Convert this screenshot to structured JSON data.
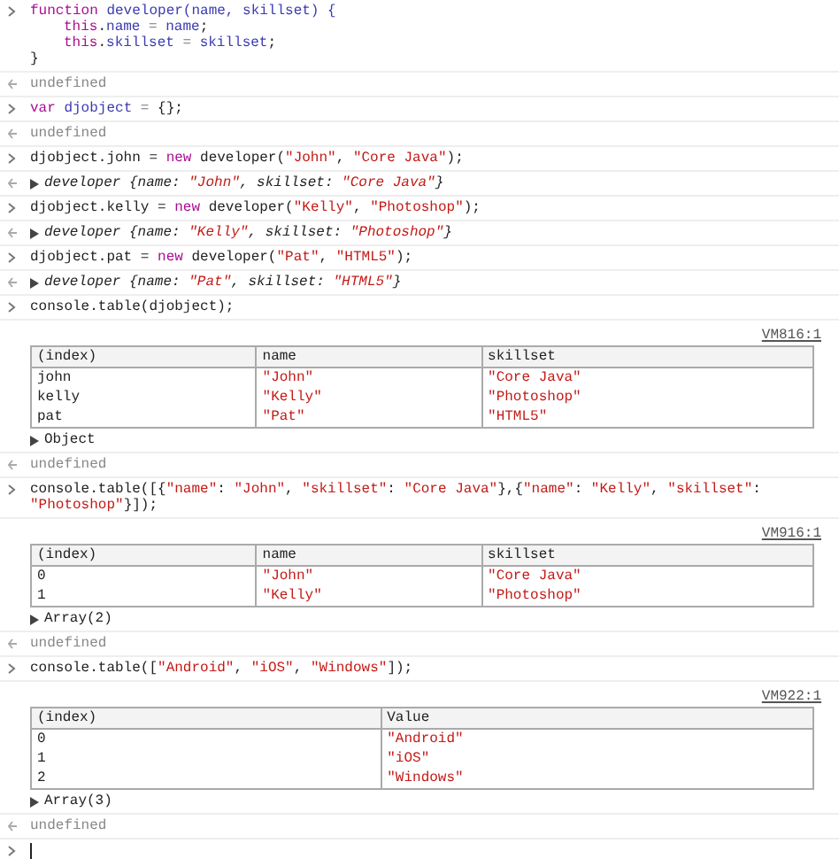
{
  "entries": [
    {
      "kind": "input",
      "lines": [
        {
          "segments": [
            {
              "kind": "kw",
              "text": "function"
            },
            {
              "kind": "def",
              "text": " developer(name, skillset) {"
            }
          ],
          "children": [
            {
              "segments": [
                {
                  "kind": "kw",
                  "text": "this"
                },
                {
                  "kind": "plain",
                  "text": "."
                },
                {
                  "kind": "def",
                  "text": "name"
                },
                {
                  "kind": "op",
                  "text": " = "
                },
                {
                  "kind": "def",
                  "text": "name"
                },
                {
                  "kind": "plain",
                  "text": ";"
                }
              ]
            },
            {
              "segments": [
                {
                  "kind": "kw",
                  "text": "this"
                },
                {
                  "kind": "plain",
                  "text": "."
                },
                {
                  "kind": "def",
                  "text": "skillset"
                },
                {
                  "kind": "op",
                  "text": " = "
                },
                {
                  "kind": "def",
                  "text": "skillset"
                },
                {
                  "kind": "plain",
                  "text": ";"
                }
              ]
            }
          ]
        },
        {
          "segments": [
            {
              "kind": "plain",
              "text": "}"
            }
          ]
        }
      ]
    },
    {
      "kind": "result",
      "text": "undefined"
    },
    {
      "kind": "input",
      "lines": [
        {
          "segments": [
            {
              "kind": "kw",
              "text": "var"
            },
            {
              "kind": "def",
              "text": " djobject"
            },
            {
              "kind": "op",
              "text": " = "
            },
            {
              "kind": "plain",
              "text": "{};"
            }
          ]
        }
      ]
    },
    {
      "kind": "result",
      "text": "undefined"
    },
    {
      "kind": "input",
      "lines": [
        {
          "segments": [
            {
              "kind": "plain",
              "text": "djobject.john = "
            },
            {
              "kind": "kw",
              "text": "new"
            },
            {
              "kind": "plain",
              "text": " developer("
            },
            {
              "kind": "str",
              "text": "\"John\""
            },
            {
              "kind": "plain",
              "text": ", "
            },
            {
              "kind": "str",
              "text": "\"Core Java\""
            },
            {
              "kind": "plain",
              "text": ");"
            }
          ]
        }
      ]
    },
    {
      "kind": "object",
      "segments": [
        {
          "kind": "plain",
          "text": "developer {name: "
        },
        {
          "kind": "str",
          "text": "\"John\""
        },
        {
          "kind": "plain",
          "text": ", skillset: "
        },
        {
          "kind": "str",
          "text": "\"Core Java\""
        },
        {
          "kind": "plain",
          "text": "}"
        }
      ]
    },
    {
      "kind": "input",
      "lines": [
        {
          "segments": [
            {
              "kind": "plain",
              "text": "djobject.kelly = "
            },
            {
              "kind": "kw",
              "text": "new"
            },
            {
              "kind": "plain",
              "text": " developer("
            },
            {
              "kind": "str",
              "text": "\"Kelly\""
            },
            {
              "kind": "plain",
              "text": ", "
            },
            {
              "kind": "str",
              "text": "\"Photoshop\""
            },
            {
              "kind": "plain",
              "text": ");"
            }
          ]
        }
      ]
    },
    {
      "kind": "object",
      "segments": [
        {
          "kind": "plain",
          "text": "developer {name: "
        },
        {
          "kind": "str",
          "text": "\"Kelly\""
        },
        {
          "kind": "plain",
          "text": ", skillset: "
        },
        {
          "kind": "str",
          "text": "\"Photoshop\""
        },
        {
          "kind": "plain",
          "text": "}"
        }
      ]
    },
    {
      "kind": "input",
      "lines": [
        {
          "segments": [
            {
              "kind": "plain",
              "text": "djobject.pat = "
            },
            {
              "kind": "kw",
              "text": "new"
            },
            {
              "kind": "plain",
              "text": " developer("
            },
            {
              "kind": "str",
              "text": "\"Pat\""
            },
            {
              "kind": "plain",
              "text": ", "
            },
            {
              "kind": "str",
              "text": "\"HTML5\""
            },
            {
              "kind": "plain",
              "text": ");"
            }
          ]
        }
      ]
    },
    {
      "kind": "object",
      "segments": [
        {
          "kind": "plain",
          "text": "developer {name: "
        },
        {
          "kind": "str",
          "text": "\"Pat\""
        },
        {
          "kind": "plain",
          "text": ", skillset: "
        },
        {
          "kind": "str",
          "text": "\"HTML5\""
        },
        {
          "kind": "plain",
          "text": "}"
        }
      ]
    },
    {
      "kind": "input",
      "lines": [
        {
          "segments": [
            {
              "kind": "plain",
              "text": "console.table(djobject);"
            }
          ]
        }
      ]
    },
    {
      "kind": "table",
      "source": "VM816:1",
      "columns": [
        "(index)",
        "name",
        "skillset"
      ],
      "rows": [
        [
          "john",
          "\"John\"",
          "\"Core Java\""
        ],
        [
          "kelly",
          "\"Kelly\"",
          "\"Photoshop\""
        ],
        [
          "pat",
          "\"Pat\"",
          "\"HTML5\""
        ]
      ],
      "summary": "Object"
    },
    {
      "kind": "result",
      "text": "undefined"
    },
    {
      "kind": "input",
      "lines": [
        {
          "segments": [
            {
              "kind": "plain",
              "text": "console.table([{"
            },
            {
              "kind": "str",
              "text": "\"name\""
            },
            {
              "kind": "plain",
              "text": ": "
            },
            {
              "kind": "str",
              "text": "\"John\""
            },
            {
              "kind": "plain",
              "text": ", "
            },
            {
              "kind": "str",
              "text": "\"skillset\""
            },
            {
              "kind": "plain",
              "text": ": "
            },
            {
              "kind": "str",
              "text": "\"Core Java\""
            },
            {
              "kind": "plain",
              "text": "},{"
            },
            {
              "kind": "str",
              "text": "\"name\""
            },
            {
              "kind": "plain",
              "text": ": "
            },
            {
              "kind": "str",
              "text": "\"Kelly\""
            },
            {
              "kind": "plain",
              "text": ", "
            },
            {
              "kind": "str",
              "text": "\"skillset\""
            },
            {
              "kind": "plain",
              "text": ":"
            }
          ]
        },
        {
          "segments": [
            {
              "kind": "str",
              "text": "\"Photoshop\""
            },
            {
              "kind": "plain",
              "text": "}]);"
            }
          ]
        }
      ]
    },
    {
      "kind": "table",
      "source": "VM916:1",
      "columns": [
        "(index)",
        "name",
        "skillset"
      ],
      "rows": [
        [
          "0",
          "\"John\"",
          "\"Core Java\""
        ],
        [
          "1",
          "\"Kelly\"",
          "\"Photoshop\""
        ]
      ],
      "summary": "Array(2)"
    },
    {
      "kind": "result",
      "text": "undefined"
    },
    {
      "kind": "input",
      "lines": [
        {
          "segments": [
            {
              "kind": "plain",
              "text": "console.table(["
            },
            {
              "kind": "str",
              "text": "\"Android\""
            },
            {
              "kind": "plain",
              "text": ", "
            },
            {
              "kind": "str",
              "text": "\"iOS\""
            },
            {
              "kind": "plain",
              "text": ", "
            },
            {
              "kind": "str",
              "text": "\"Windows\""
            },
            {
              "kind": "plain",
              "text": "]);"
            }
          ]
        }
      ]
    },
    {
      "kind": "table",
      "source": "VM922:1",
      "columns": [
        "(index)",
        "Value"
      ],
      "rows": [
        [
          "0",
          "\"Android\""
        ],
        [
          "1",
          "\"iOS\""
        ],
        [
          "2",
          "\"Windows\""
        ]
      ],
      "summary": "Array(3)"
    },
    {
      "kind": "result",
      "text": "undefined"
    },
    {
      "kind": "prompt"
    }
  ]
}
